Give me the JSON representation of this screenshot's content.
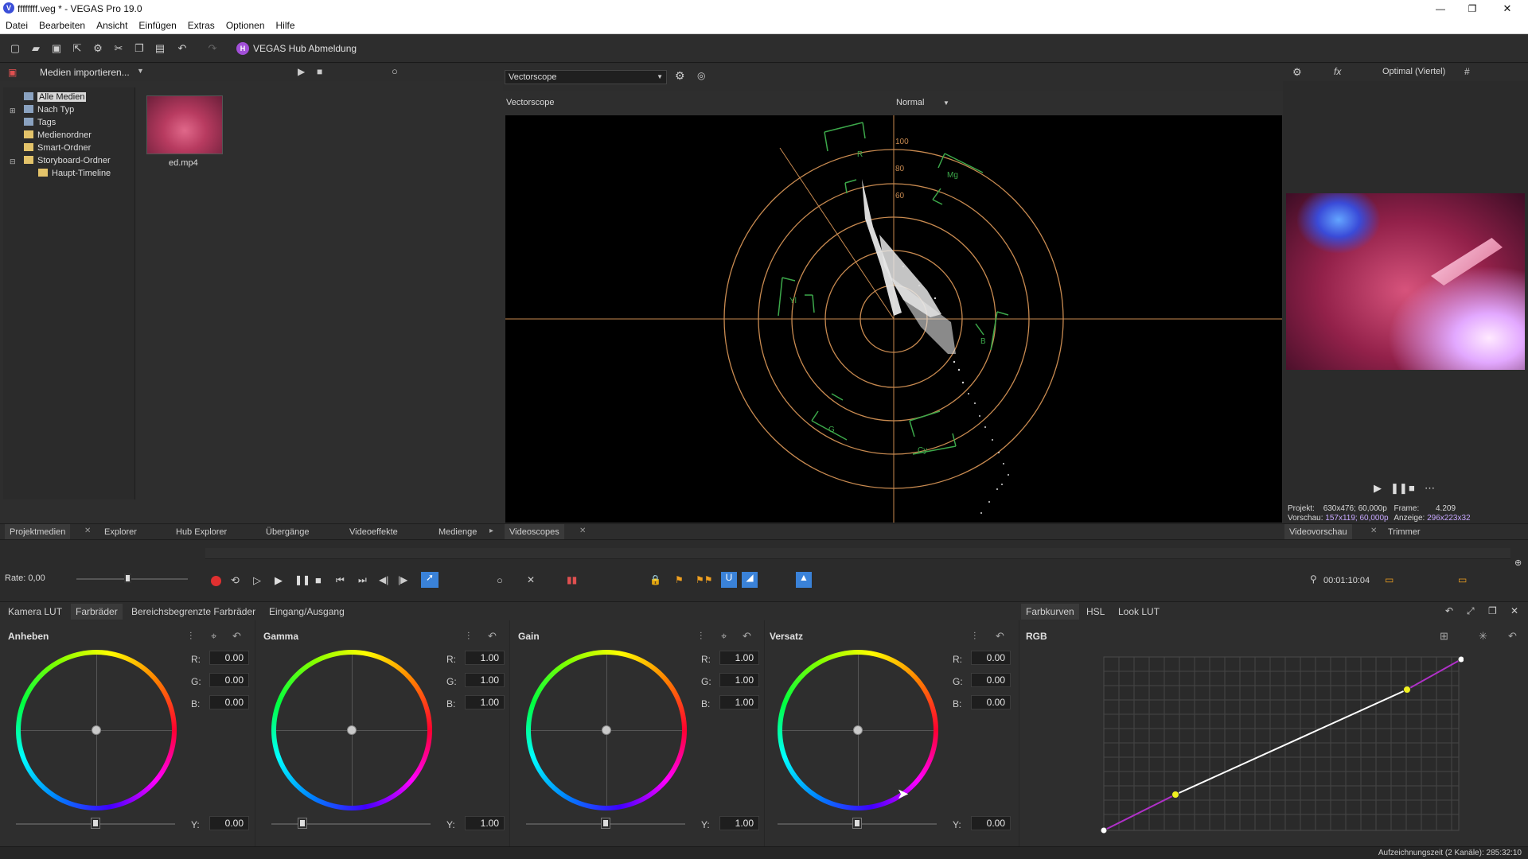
{
  "window": {
    "title": "ffffffff.veg * - VEGAS Pro 19.0",
    "minimize": "—",
    "maximize": "❐",
    "close": "✕"
  },
  "menu": [
    "Datei",
    "Bearbeiten",
    "Ansicht",
    "Einfügen",
    "Extras",
    "Optionen",
    "Hilfe"
  ],
  "toolbar": {
    "hub_label": "VEGAS Hub Abmeldung"
  },
  "media": {
    "import_label": "Medien importieren...",
    "tree": [
      {
        "label": "Alle Medien",
        "selected": true
      },
      {
        "label": "Nach Typ"
      },
      {
        "label": "Tags"
      },
      {
        "label": "Medienordner"
      },
      {
        "label": "Smart-Ordner"
      },
      {
        "label": "Storyboard-Ordner"
      },
      {
        "label": "Haupt-Timeline"
      }
    ],
    "thumb_label": "ed.mp4",
    "tabs": [
      "Projektmedien",
      "Explorer",
      "Hub Explorer",
      "Übergänge",
      "Videoeffekte",
      "Medienge"
    ]
  },
  "scope": {
    "dropdown": "Vectorscope",
    "header_label": "Vectorscope",
    "mode": "Normal",
    "tab": "Videoscopes",
    "ring_labels": [
      "100",
      "80",
      "60"
    ],
    "color_labels": [
      "R",
      "Mg",
      "Yl",
      "B",
      "G",
      "Cy"
    ]
  },
  "preview": {
    "quality": "Optimal (Viertel)",
    "projekt_label": "Projekt:",
    "projekt_value": "630x476; 60,000p",
    "frame_label": "Frame:",
    "frame_value": "4.209",
    "vorschau_label": "Vorschau:",
    "vorschau_value": "157x119; 60,000p",
    "anzeige_label": "Anzeige:",
    "anzeige_value": "296x223x32",
    "tabs": [
      "Videovorschau",
      "Trimmer"
    ]
  },
  "transport": {
    "rate": "Rate: 0,00",
    "timecode": "00:01:10:04"
  },
  "color": {
    "tabs": [
      "Kamera LUT",
      "Farbräder",
      "Bereichsbegrenzte Farbräder",
      "Eingang/Ausgang"
    ],
    "right_tabs": [
      "Farbkurven",
      "HSL",
      "Look LUT"
    ],
    "wheels": [
      {
        "name": "Anheben",
        "r": "0.00",
        "g": "0.00",
        "b": "0.00",
        "y": "0.00"
      },
      {
        "name": "Gamma",
        "r": "1.00",
        "g": "1.00",
        "b": "1.00",
        "y": "1.00"
      },
      {
        "name": "Gain",
        "r": "1.00",
        "g": "1.00",
        "b": "1.00",
        "y": "1.00"
      },
      {
        "name": "Versatz",
        "r": "0.00",
        "g": "0.00",
        "b": "0.00",
        "y": "0.00"
      }
    ],
    "rgb_label": "RGB",
    "r_lbl": "R:",
    "g_lbl": "G:",
    "b_lbl": "B:",
    "y_lbl": "Y:"
  },
  "status": {
    "text": "Aufzeichnungszeit (2 Kanäle): 285:32:10"
  },
  "colors": {
    "accent": "#3a82d8",
    "record": "#e03030",
    "scope_ring": "#d08a4a",
    "scope_target": "#3aa84a"
  }
}
